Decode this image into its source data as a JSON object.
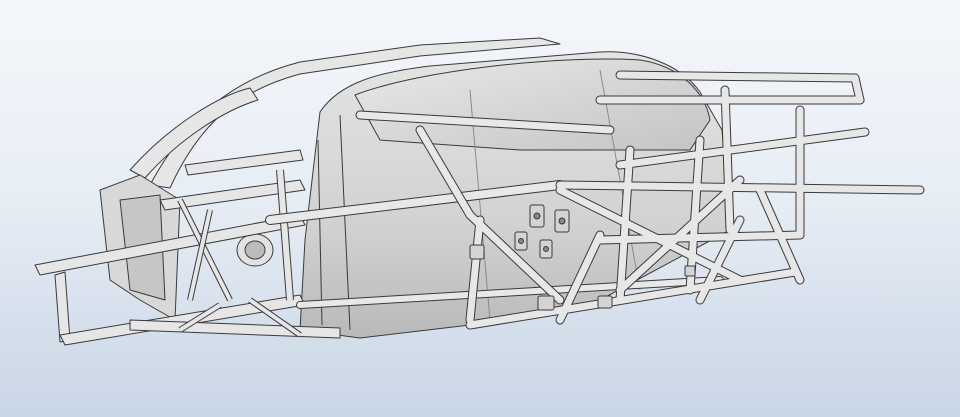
{
  "viewport": {
    "background_top": "#f4f7fb",
    "background_bottom": "#c9d6e6"
  },
  "model": {
    "icon": "chassis-wireframe-model",
    "body_fill": "#d9d9d9",
    "body_shade": "#bdbdbd",
    "tube_fill": "#e6e6e6",
    "edge_color": "#3a3a3a"
  }
}
